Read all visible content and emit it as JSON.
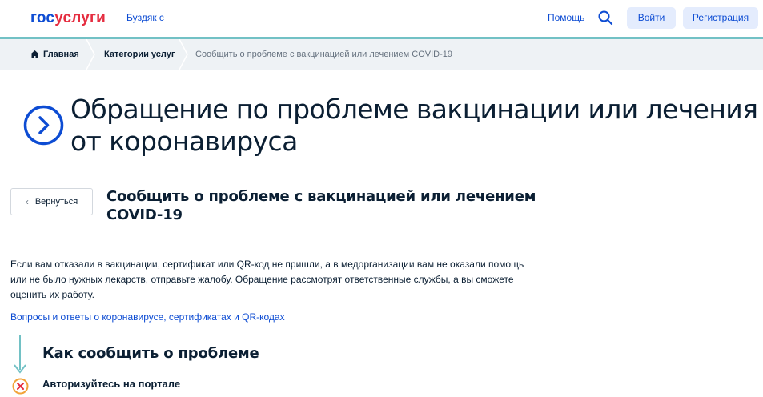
{
  "header": {
    "logo_part1": "гос",
    "logo_part2": "услуги",
    "city": "Буздяк с",
    "help": "Помощь",
    "login": "Войти",
    "register": "Регистрация"
  },
  "breadcrumbs": {
    "home": "Главная",
    "category": "Категории услуг",
    "current": "Сообщить о проблеме с вакцинацией или лечением COVID-19"
  },
  "page": {
    "title": "Обращение по проблеме вакцинации или лечения от коронавируса",
    "back_label": "Вернуться",
    "subtitle": "Сообщить о проблеме с вакцинацией или лечением COVID-19",
    "description": "Если вам отказали в вакцинации, сертификат или QR-код не пришли, а в медорганизации вам не оказали помощь или не было нужных лекарств, отправьте жалобу. Обращение рассмотрят ответственные службы, а вы сможете оценить их работу.",
    "faq_link": "Вопросы и ответы о коронавирусе, сертификатах и QR-кодах",
    "how_title": "Как сообщить о проблеме",
    "step1": "Авторизуйтесь на портале"
  },
  "colors": {
    "brand_blue": "#0d4cd3",
    "brand_red": "#e52d40",
    "accent_teal": "#72c1c5",
    "warning_orange": "#f2a43a"
  },
  "icons": {
    "search": "search-icon",
    "home": "home-icon",
    "title": "chevron-circle-right-icon",
    "back": "chevron-left-icon",
    "arrow": "arrow-down-icon",
    "step_status": "close-circle-icon"
  }
}
